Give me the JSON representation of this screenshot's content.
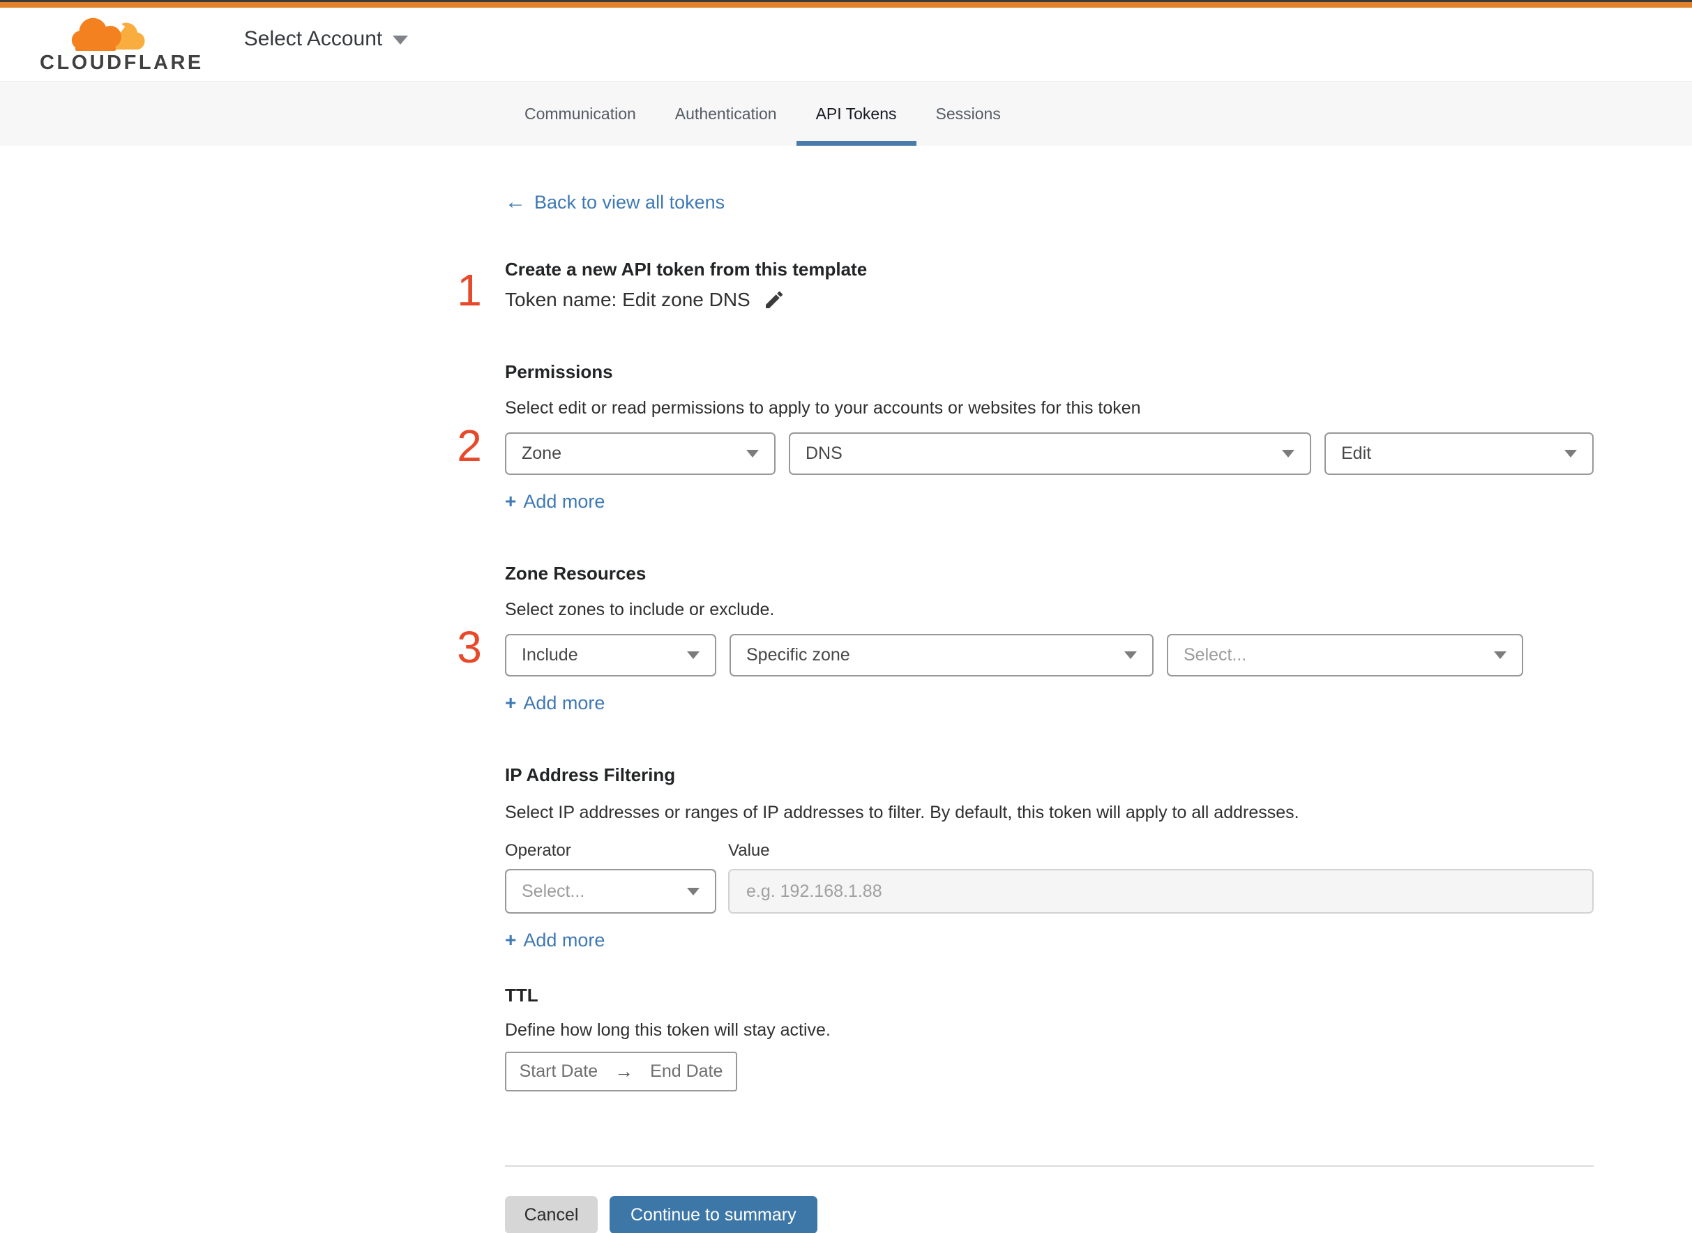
{
  "header": {
    "logo_text": "CLOUDFLARE",
    "account_selector": {
      "label": "Select Account"
    }
  },
  "tabs": [
    {
      "label": "Communication",
      "active": false
    },
    {
      "label": "Authentication",
      "active": false
    },
    {
      "label": "API Tokens",
      "active": true
    },
    {
      "label": "Sessions",
      "active": false
    }
  ],
  "back_link": {
    "arrow": "←",
    "label": "Back to view all tokens"
  },
  "token_section": {
    "step": "1",
    "heading": "Create a new API token from this template",
    "token_name": "Token name: Edit zone DNS"
  },
  "permissions_section": {
    "step": "2",
    "heading": "Permissions",
    "description": "Select edit or read permissions to apply to your accounts or websites for this token",
    "scope_select": "Zone",
    "resource_select": "DNS",
    "access_select": "Edit",
    "plus": "+",
    "add_more": "Add more"
  },
  "zone_resources_section": {
    "step": "3",
    "heading": "Zone Resources",
    "description": "Select zones to include or exclude.",
    "mode_select": "Include",
    "type_select": "Specific zone",
    "zone_select_placeholder": "Select...",
    "plus": "+",
    "add_more": "Add more"
  },
  "ip_filtering_section": {
    "heading": "IP Address Filtering",
    "description": "Select IP addresses or ranges of IP addresses to filter. By default, this token will apply to all addresses.",
    "operator_label": "Operator",
    "value_label": "Value",
    "operator_select_placeholder": "Select...",
    "value_placeholder": "e.g. 192.168.1.88",
    "plus": "+",
    "add_more": "Add more"
  },
  "ttl_section": {
    "heading": "TTL",
    "description": "Define how long this token will stay active.",
    "start_date": "Start Date",
    "arrow": "→",
    "end_date": "End Date"
  },
  "footer": {
    "cancel": "Cancel",
    "continue": "Continue to summary"
  },
  "colors": {
    "accent_orange": "#f48120",
    "topbar_orange": "#e0812e",
    "step_number": "#e8492a",
    "link_blue": "#3e79b4",
    "active_tab_underline": "#4a7cab",
    "primary_button": "#3d77a8"
  }
}
